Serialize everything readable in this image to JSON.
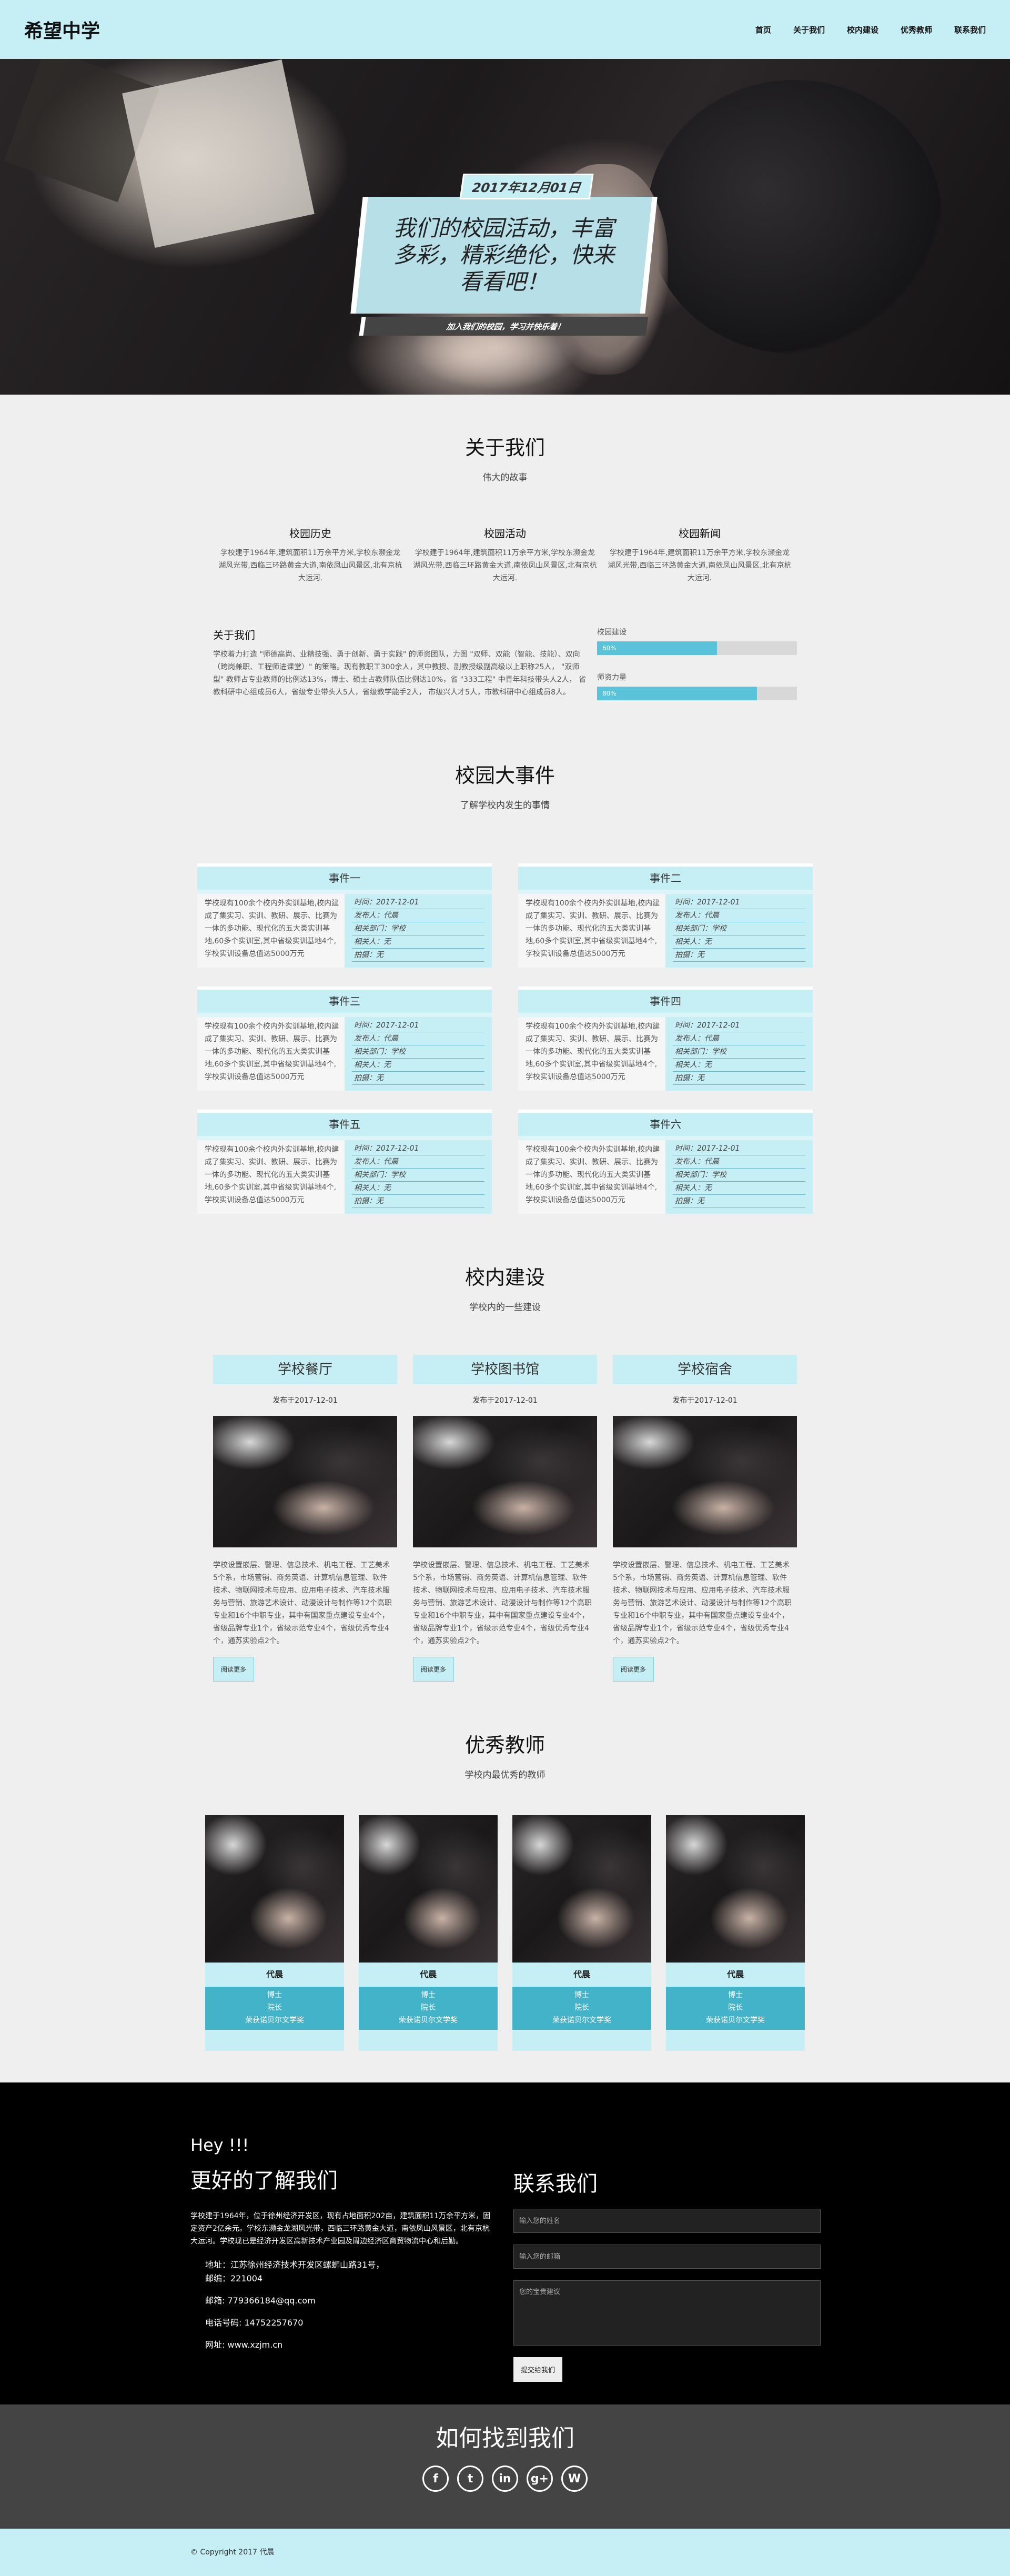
{
  "nav": {
    "brand": "希望中学",
    "items": [
      "首页",
      "关于我们",
      "校内建设",
      "优秀教师",
      "联系我们"
    ]
  },
  "hero": {
    "date": "2017年12月01日",
    "title": "我们的校园活动，丰富多彩，精彩绝伦，快来看看吧！",
    "subtitle": "加入我们的校园，学习并快乐着！"
  },
  "about": {
    "title": "关于我们",
    "subtitle": "伟大的故事",
    "cols": [
      {
        "title": "校园历史",
        "text": "学校建于1964年,建筑面积11万余平方米,学校东濒金龙湖风光带,西临三环路黄金大道,南依凤山风景区,北有京杭大运河."
      },
      {
        "title": "校园活动",
        "text": "学校建于1964年,建筑面积11万余平方米,学校东濒金龙湖风光带,西临三环路黄金大道,南依凤山风景区,北有京杭大运河."
      },
      {
        "title": "校园新闻",
        "text": "学校建于1964年,建筑面积11万余平方米,学校东濒金龙湖风光带,西临三环路黄金大道,南依凤山风景区,北有京杭大运河."
      }
    ],
    "left_title": "关于我们",
    "left_text": "学校着力打造 \"师德高尚、业精技强、勇于创新、勇于实践\" 的师资团队，力图 \"双师、双能（智能、技能）、双向（跨岗兼职、工程师进课堂）\" 的策略。现有教职工300余人，其中教授、副教授级副高级以上职称25人， \"双师型\" 教师占专业教师的比例达13%，博士、硕士占教师队伍比例达10%，省 \"333工程\" 中青年科技带头人2人， 省教科研中心组成员6人，省级专业带头人5人，省级教学能手2人， 市级兴人才5人，市教科研中心组成员8人。",
    "skills": [
      {
        "label": "校园建设",
        "percent": 60,
        "text": "60%"
      },
      {
        "label": "师资力量",
        "percent": 80,
        "text": "80%"
      }
    ]
  },
  "events": {
    "title": "校园大事件",
    "subtitle": "了解学校内发生的事情",
    "text": "学校现有100余个校内外实训基地,校内建成了集实习、实训、教研、展示、比赛为一体的多功能、现代化的五大类实训基地,60多个实训室,其中省级实训基地4个,学校实训设备总值达5000万元",
    "meta": [
      "时间：2017-12-01",
      "发布人：代晨",
      "相关部门：学校",
      "相关人：无",
      "拍摄：无"
    ],
    "items": [
      "事件一",
      "事件二",
      "事件三",
      "事件四",
      "事件五",
      "事件六"
    ]
  },
  "builds": {
    "title": "校内建设",
    "subtitle": "学校内的一些建设",
    "date": "发布于2017-12-01",
    "text": "学校设置嵌层、警理、信息技术、机电工程、工艺美术5个系，市场营销、商务英语、计算机信息管理、软件技术、物联网技术与应用、应用电子技术、汽车技术服务与营销、旅游艺术设计、动漫设计与制作等12个高职专业和16个中职专业，其中有国家重点建设专业4个，省级品牌专业1个，省级示范专业4个，省级优秀专业4个，通苏实验点2个。",
    "button": "阅读更多",
    "items": [
      "学校餐厅",
      "学校图书馆",
      "学校宿舍"
    ]
  },
  "teachers": {
    "title": "优秀教师",
    "subtitle": "学校内最优秀的教师",
    "items": [
      {
        "name": "代晨",
        "degree": "博士",
        "role": "院长",
        "desc": "荣获诺贝尔文学奖"
      },
      {
        "name": "代晨",
        "degree": "博士",
        "role": "院长",
        "desc": "荣获诺贝尔文学奖"
      },
      {
        "name": "代晨",
        "degree": "博士",
        "role": "院长",
        "desc": "荣获诺贝尔文学奖"
      },
      {
        "name": "代晨",
        "degree": "博士",
        "role": "院长",
        "desc": "荣获诺贝尔文学奖"
      }
    ]
  },
  "contact": {
    "hey": "Hey !!!",
    "title": "更好的了解我们",
    "text": "学校建于1964年，位于徐州经济开发区，现有占地面积202亩，建筑面积11万余平方米，固定资产2亿余元。学校东濒金龙湖风光带，西临三环路黄金大道，南依凤山风景区，北有京杭大运河。学校现已是经济开发区高新技术产业园及周边经济区商贸物流中心和后勤。",
    "address": "地址：江苏徐州经济技术开发区螺蛳山路31号，",
    "zip": "邮编：221004",
    "email": "邮箱: 779366184@qq.com",
    "phone": "电话号码: 14752257670",
    "website": "网址: www.xzjm.cn",
    "form_title": "联系我们",
    "name_placeholder": "输入您的姓名",
    "email_placeholder": "输入您的邮箱",
    "message_placeholder": "您的宝贵建议",
    "submit": "提交给我们"
  },
  "find": {
    "title": "如何找到我们",
    "icons": [
      "facebook-icon",
      "twitter-icon",
      "linkedin-icon",
      "googleplus-icon",
      "wordpress-icon"
    ],
    "glyphs": [
      "f",
      "t",
      "in",
      "g+",
      "W"
    ]
  },
  "footer": {
    "copyright": "© Copyright 2017 代晨"
  }
}
